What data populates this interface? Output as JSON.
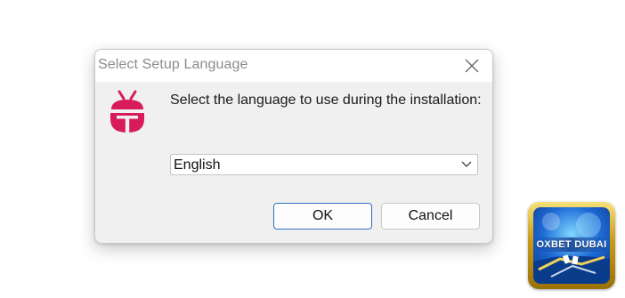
{
  "dialog": {
    "title": "Select Setup Language",
    "prompt": "Select the language to use during the installation:",
    "language_select": {
      "selected": "English"
    },
    "ok_label": "OK",
    "cancel_label": "Cancel"
  },
  "icons": {
    "close": "close-icon",
    "app": "setup-app-icon",
    "dropdown": "chevron-down-icon"
  },
  "badge": {
    "text": "OXBET DUBAI"
  },
  "colors": {
    "app_icon": "#d81b5a",
    "ok_border": "#2f6fbf",
    "dialog_bg": "#f0f0f0"
  }
}
